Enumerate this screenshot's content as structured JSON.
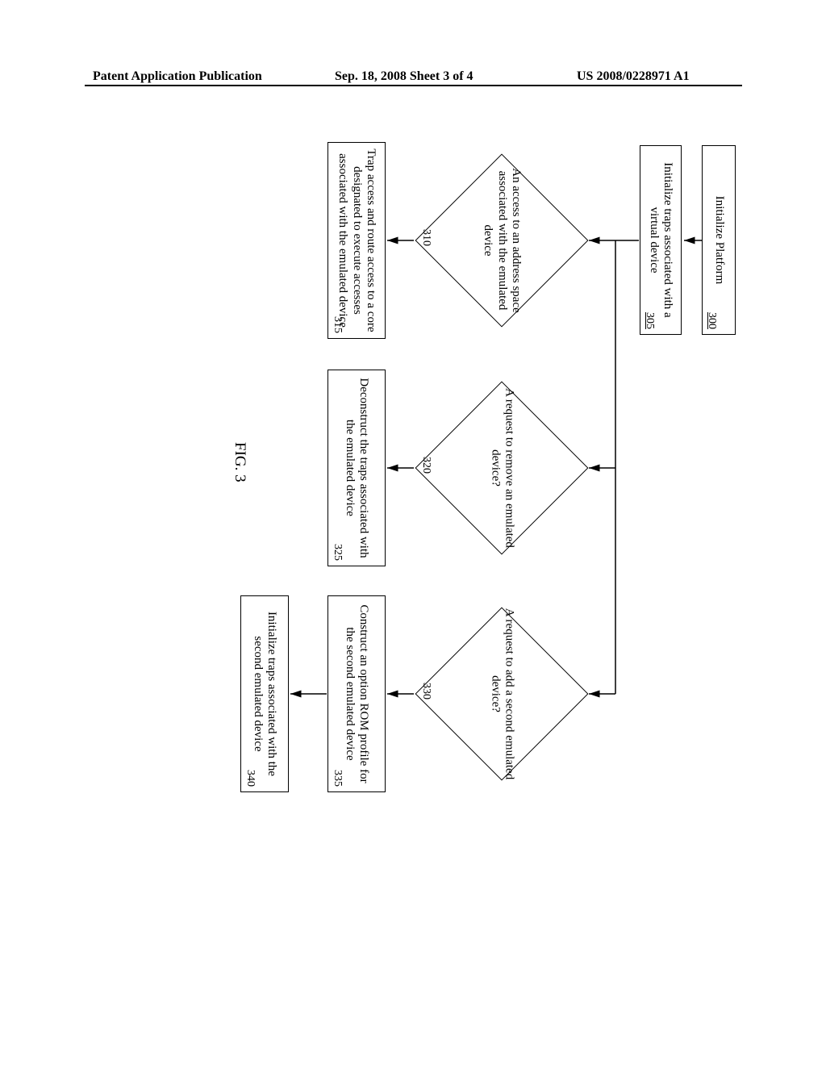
{
  "header": {
    "left": "Patent Application Publication",
    "center": "Sep. 18, 2008  Sheet 3 of 4",
    "right": "US 2008/0228971 A1"
  },
  "figure_label": "FIG. 3",
  "boxes": {
    "b300": {
      "text": "Initialize Platform",
      "ref": "300"
    },
    "b305": {
      "text": "Initialize traps associated with a virtual device",
      "ref": "305"
    },
    "b315": {
      "text": "Trap access and route access to a core designated to execute accesses associated with the emulated device",
      "ref": "315"
    },
    "b325": {
      "text": "Deconstruct the traps associated with the emulated device",
      "ref": "325"
    },
    "b335": {
      "text": "Construct an option ROM profile for the second emulated device",
      "ref": "335"
    },
    "b340": {
      "text": "Initialize traps associated with the second emulated device",
      "ref": "340"
    }
  },
  "diamonds": {
    "d310": {
      "text": "An access to an address space associated with the emulated device",
      "ref": "310"
    },
    "d320": {
      "text": "A request to remove an emulated device?",
      "ref": "320"
    },
    "d330": {
      "text": "A request to add a second emulated device?",
      "ref": "330"
    }
  }
}
